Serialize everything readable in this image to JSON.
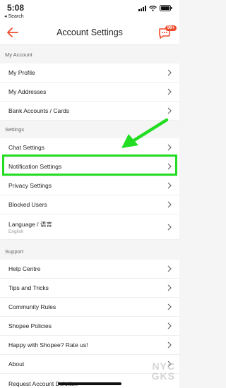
{
  "status_bar": {
    "time": "5:08",
    "back_label": "◂ Search"
  },
  "header": {
    "title": "Account Settings",
    "badge": "99+"
  },
  "colors": {
    "accent": "#ee4d2d",
    "highlight": "#22dd22"
  },
  "sections": {
    "my_account": {
      "title": "My Account",
      "items": [
        {
          "label": "My Profile"
        },
        {
          "label": "My Addresses"
        },
        {
          "label": "Bank Accounts / Cards"
        }
      ]
    },
    "settings": {
      "title": "Settings",
      "items": [
        {
          "label": "Chat Settings"
        },
        {
          "label": "Notification Settings"
        },
        {
          "label": "Privacy Settings"
        },
        {
          "label": "Blocked Users"
        },
        {
          "label": "Language / 语言",
          "sub": "English"
        }
      ]
    },
    "support": {
      "title": "Support",
      "items": [
        {
          "label": "Help Centre"
        },
        {
          "label": "Tips and Tricks"
        },
        {
          "label": "Community Rules"
        },
        {
          "label": "Shopee Policies"
        },
        {
          "label": "Happy with Shopee? Rate us!"
        },
        {
          "label": "About"
        },
        {
          "label": "Request Account Deletion"
        }
      ]
    }
  },
  "watermark": {
    "line1": "NYC",
    "line2": "GKS"
  },
  "icons": [
    "back-arrow-icon",
    "chat-icon",
    "chevron-right-icon",
    "signal-icon",
    "wifi-icon",
    "battery-icon"
  ]
}
